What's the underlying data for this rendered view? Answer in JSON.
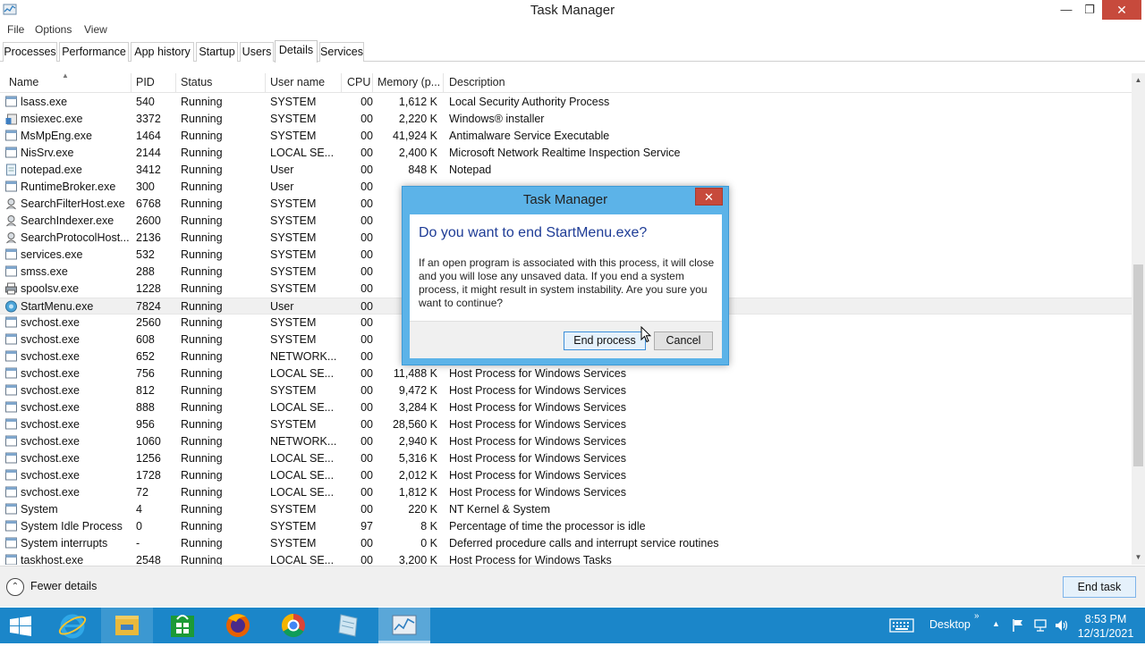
{
  "window": {
    "title": "Task Manager",
    "controls": {
      "minimize": "—",
      "maximize": "❐",
      "close": "✕"
    }
  },
  "menu": [
    "File",
    "Options",
    "View"
  ],
  "tabs": [
    "Processes",
    "Performance",
    "App history",
    "Startup",
    "Users",
    "Details",
    "Services"
  ],
  "active_tab": "Details",
  "table": {
    "columns": [
      "Name",
      "PID",
      "Status",
      "User name",
      "CPU",
      "Memory (p...",
      "Description"
    ],
    "rows": [
      {
        "icon": "generic-process-icon",
        "name": "lsass.exe",
        "pid": "540",
        "status": "Running",
        "user": "SYSTEM",
        "cpu": "00",
        "mem": "1,612 K",
        "desc": "Local Security Authority Process"
      },
      {
        "icon": "installer-icon",
        "name": "msiexec.exe",
        "pid": "3372",
        "status": "Running",
        "user": "SYSTEM",
        "cpu": "00",
        "mem": "2,220 K",
        "desc": "Windows® installer"
      },
      {
        "icon": "generic-process-icon",
        "name": "MsMpEng.exe",
        "pid": "1464",
        "status": "Running",
        "user": "SYSTEM",
        "cpu": "00",
        "mem": "41,924 K",
        "desc": "Antimalware Service Executable"
      },
      {
        "icon": "generic-process-icon",
        "name": "NisSrv.exe",
        "pid": "2144",
        "status": "Running",
        "user": "LOCAL SE...",
        "cpu": "00",
        "mem": "2,400 K",
        "desc": "Microsoft Network Realtime Inspection Service"
      },
      {
        "icon": "notepad-icon",
        "name": "notepad.exe",
        "pid": "3412",
        "status": "Running",
        "user": "User",
        "cpu": "00",
        "mem": "848 K",
        "desc": "Notepad"
      },
      {
        "icon": "generic-process-icon",
        "name": "RuntimeBroker.exe",
        "pid": "300",
        "status": "Running",
        "user": "User",
        "cpu": "00",
        "mem": "",
        "desc": ""
      },
      {
        "icon": "search-process-icon",
        "name": "SearchFilterHost.exe",
        "pid": "6768",
        "status": "Running",
        "user": "SYSTEM",
        "cpu": "00",
        "mem": "",
        "desc": ""
      },
      {
        "icon": "search-process-icon",
        "name": "SearchIndexer.exe",
        "pid": "2600",
        "status": "Running",
        "user": "SYSTEM",
        "cpu": "00",
        "mem": "",
        "desc": ""
      },
      {
        "icon": "search-process-icon",
        "name": "SearchProtocolHost....",
        "pid": "2136",
        "status": "Running",
        "user": "SYSTEM",
        "cpu": "00",
        "mem": "",
        "desc": ""
      },
      {
        "icon": "generic-process-icon",
        "name": "services.exe",
        "pid": "532",
        "status": "Running",
        "user": "SYSTEM",
        "cpu": "00",
        "mem": "",
        "desc": ""
      },
      {
        "icon": "generic-process-icon",
        "name": "smss.exe",
        "pid": "288",
        "status": "Running",
        "user": "SYSTEM",
        "cpu": "00",
        "mem": "",
        "desc": ""
      },
      {
        "icon": "printer-icon",
        "name": "spoolsv.exe",
        "pid": "1228",
        "status": "Running",
        "user": "SYSTEM",
        "cpu": "00",
        "mem": "",
        "desc": ""
      },
      {
        "icon": "startmenu-icon",
        "name": "StartMenu.exe",
        "pid": "7824",
        "status": "Running",
        "user": "User",
        "cpu": "00",
        "mem": "",
        "desc": "",
        "selected": true
      },
      {
        "icon": "generic-process-icon",
        "name": "svchost.exe",
        "pid": "2560",
        "status": "Running",
        "user": "SYSTEM",
        "cpu": "00",
        "mem": "",
        "desc": ""
      },
      {
        "icon": "generic-process-icon",
        "name": "svchost.exe",
        "pid": "608",
        "status": "Running",
        "user": "SYSTEM",
        "cpu": "00",
        "mem": "",
        "desc": ""
      },
      {
        "icon": "generic-process-icon",
        "name": "svchost.exe",
        "pid": "652",
        "status": "Running",
        "user": "NETWORK...",
        "cpu": "00",
        "mem": "",
        "desc": ""
      },
      {
        "icon": "generic-process-icon",
        "name": "svchost.exe",
        "pid": "756",
        "status": "Running",
        "user": "LOCAL SE...",
        "cpu": "00",
        "mem": "11,488 K",
        "desc": "Host Process for Windows Services"
      },
      {
        "icon": "generic-process-icon",
        "name": "svchost.exe",
        "pid": "812",
        "status": "Running",
        "user": "SYSTEM",
        "cpu": "00",
        "mem": "9,472 K",
        "desc": "Host Process for Windows Services"
      },
      {
        "icon": "generic-process-icon",
        "name": "svchost.exe",
        "pid": "888",
        "status": "Running",
        "user": "LOCAL SE...",
        "cpu": "00",
        "mem": "3,284 K",
        "desc": "Host Process for Windows Services"
      },
      {
        "icon": "generic-process-icon",
        "name": "svchost.exe",
        "pid": "956",
        "status": "Running",
        "user": "SYSTEM",
        "cpu": "00",
        "mem": "28,560 K",
        "desc": "Host Process for Windows Services"
      },
      {
        "icon": "generic-process-icon",
        "name": "svchost.exe",
        "pid": "1060",
        "status": "Running",
        "user": "NETWORK...",
        "cpu": "00",
        "mem": "2,940 K",
        "desc": "Host Process for Windows Services"
      },
      {
        "icon": "generic-process-icon",
        "name": "svchost.exe",
        "pid": "1256",
        "status": "Running",
        "user": "LOCAL SE...",
        "cpu": "00",
        "mem": "5,316 K",
        "desc": "Host Process for Windows Services"
      },
      {
        "icon": "generic-process-icon",
        "name": "svchost.exe",
        "pid": "1728",
        "status": "Running",
        "user": "LOCAL SE...",
        "cpu": "00",
        "mem": "2,012 K",
        "desc": "Host Process for Windows Services"
      },
      {
        "icon": "generic-process-icon",
        "name": "svchost.exe",
        "pid": "72",
        "status": "Running",
        "user": "LOCAL SE...",
        "cpu": "00",
        "mem": "1,812 K",
        "desc": "Host Process for Windows Services"
      },
      {
        "icon": "generic-process-icon",
        "name": "System",
        "pid": "4",
        "status": "Running",
        "user": "SYSTEM",
        "cpu": "00",
        "mem": "220 K",
        "desc": "NT Kernel & System"
      },
      {
        "icon": "generic-process-icon",
        "name": "System Idle Process",
        "pid": "0",
        "status": "Running",
        "user": "SYSTEM",
        "cpu": "97",
        "mem": "8 K",
        "desc": "Percentage of time the processor is idle"
      },
      {
        "icon": "generic-process-icon",
        "name": "System interrupts",
        "pid": "-",
        "status": "Running",
        "user": "SYSTEM",
        "cpu": "00",
        "mem": "0 K",
        "desc": "Deferred procedure calls and interrupt service routines"
      },
      {
        "icon": "generic-process-icon",
        "name": "taskhost.exe",
        "pid": "2548",
        "status": "Running",
        "user": "LOCAL SE...",
        "cpu": "00",
        "mem": "3,200 K",
        "desc": "Host Process for Windows Tasks"
      }
    ]
  },
  "footer": {
    "fewer_details": "Fewer details",
    "end_task": "End task"
  },
  "dialog": {
    "title": "Task Manager",
    "question": "Do you want to end StartMenu.exe?",
    "message": "If an open program is associated with this process, it will close and you will lose any unsaved data. If you end a system process, it might result in system instability. Are you sure you want to continue?",
    "confirm_label": "End process",
    "cancel_label": "Cancel"
  },
  "taskbar": {
    "apps": [
      "internet-explorer-icon",
      "file-explorer-icon",
      "store-icon",
      "firefox-icon",
      "chrome-icon",
      "notepad-app-icon",
      "task-manager-icon"
    ],
    "active_app": "task-manager-icon",
    "desktop_label": "Desktop",
    "time": "8:53 PM",
    "date": "12/31/2021"
  },
  "colors": {
    "taskbar": "#1b86c9",
    "dialog_frame": "#5cb3e8",
    "dialog_question": "#1e3c96",
    "close_red": "#c74a3c"
  }
}
